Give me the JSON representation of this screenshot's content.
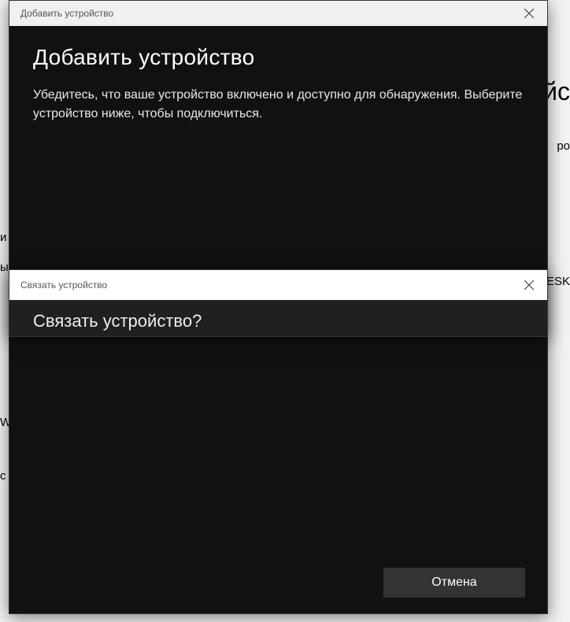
{
  "background": {
    "frag1": "йс",
    "frag2": "ро",
    "frag3": "и",
    "frag4": "ы",
    "frag5": "ESK",
    "frag6": "Wi",
    "frag7": "с"
  },
  "dialog1": {
    "titlebar": "Добавить устройство",
    "heading": "Добавить устройство",
    "description": "Убедитесь, что ваше устройство включено и доступно для обнаружения. Выберите устройство ниже, чтобы подключиться.",
    "cancel_label": "Отмена"
  },
  "dialog2": {
    "titlebar": "Связать устройство",
    "heading": "Связать устройство?"
  }
}
